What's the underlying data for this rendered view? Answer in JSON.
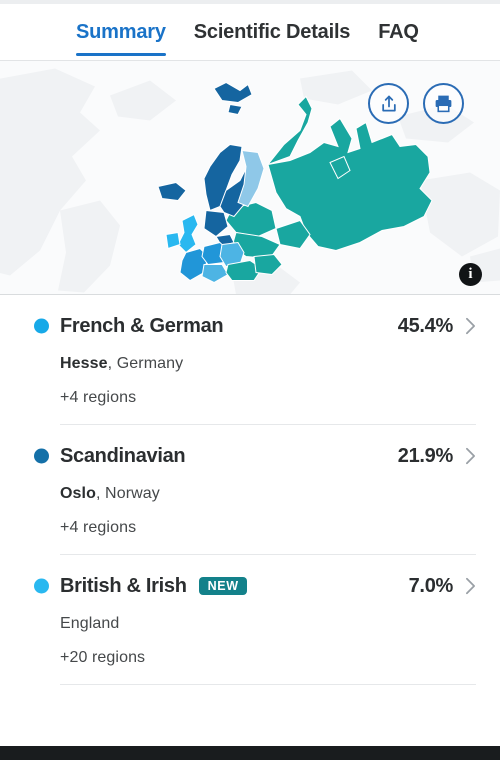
{
  "tabs": [
    {
      "label": "Summary",
      "active": true
    },
    {
      "label": "Scientific Details",
      "active": false
    },
    {
      "label": "FAQ",
      "active": false
    }
  ],
  "map": {
    "share_icon": "share-upload-icon",
    "print_icon": "printer-icon",
    "info_icon": "info-icon",
    "info_label": "i",
    "accent": "#2b6cb5",
    "background": "#fafbfc",
    "land_color": "#f1f3f5",
    "region_colors": {
      "teal": "#19a7a0",
      "dark_blue": "#1565a0",
      "light_blue": "#8fc8e8",
      "cyan": "#1aa8e8",
      "mid_blue": "#2196d8"
    }
  },
  "ancestries": [
    {
      "name": "French & German",
      "percent": "45.4%",
      "dot_color": "#17a9e8",
      "top_region": "Hesse",
      "top_country": ", Germany",
      "more_regions": "+4 regions",
      "badge": null,
      "chevron_icon": "chevron-right-icon"
    },
    {
      "name": "Scandinavian",
      "percent": "21.9%",
      "dot_color": "#1470a8",
      "top_region": "Oslo",
      "top_country": ", Norway",
      "more_regions": "+4 regions",
      "badge": null,
      "chevron_icon": "chevron-right-icon"
    },
    {
      "name": "British & Irish",
      "percent": "7.0%",
      "dot_color": "#29b8f0",
      "top_region": "",
      "top_country": "England",
      "more_regions": "+20 regions",
      "badge": "NEW",
      "chevron_icon": "chevron-right-icon"
    }
  ]
}
